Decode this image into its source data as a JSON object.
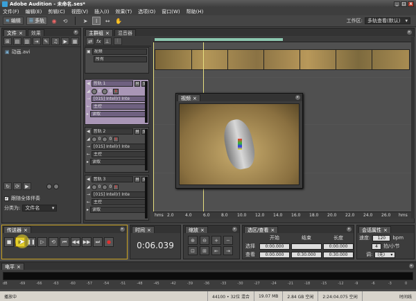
{
  "window": {
    "title": "Adobe Audition - 未命名.ses*",
    "min": "_",
    "max": "□",
    "close": "x"
  },
  "menu": [
    "文件(F)",
    "编辑(E)",
    "剪辑(C)",
    "视图(V)",
    "插入(I)",
    "效果(T)",
    "选项(O)",
    "窗口(W)",
    "帮助(H)"
  ],
  "toolbar": {
    "edit_label": "编辑",
    "multitrack_label": "多轨",
    "workspace_label": "工作区:",
    "workspace_value": "多轨查看(默认)"
  },
  "files_panel": {
    "tab_files": "文件",
    "tab_effects": "效果",
    "item": "动画.avi",
    "checkbox_label": "跟随全体伴奏",
    "sort_label": "分类为:",
    "sort_value": "文件名"
  },
  "main_panel": {
    "tab_main": "主群组",
    "tab_mixer": "混音器"
  },
  "tracks": [
    {
      "name": "视频",
      "field": "所有"
    },
    {
      "name": "音轨 1",
      "vol": "0",
      "pan": "0",
      "input": "[01S] Intel(r) Inte",
      "output": "主控",
      "mode": "读取"
    },
    {
      "name": "音轨 2",
      "vol": "0",
      "pan": "0",
      "input": "[01S] Intel(r) Inte",
      "output": "主控",
      "mode": "读取"
    },
    {
      "name": "音轨 3",
      "vol": "0",
      "pan": "0",
      "input": "[01S] Intel(r) Inte",
      "output": "主控",
      "mode": "读取"
    }
  ],
  "track_buttons": {
    "m": "M",
    "s": "S",
    "r": "R"
  },
  "video_window": {
    "tab": "视频"
  },
  "ruler": {
    "unit": "hms",
    "ticks": [
      "2.0",
      "4.0",
      "6.0",
      "8.0",
      "10.0",
      "12.0",
      "14.0",
      "16.0",
      "18.0",
      "20.0",
      "22.0",
      "24.0",
      "26.0"
    ],
    "end": "hms"
  },
  "transport": {
    "tab": "传送器"
  },
  "time": {
    "tab": "时间",
    "value": "0:06.039"
  },
  "zoom": {
    "tab": "缩放"
  },
  "selection": {
    "tab": "选区/查看",
    "col_start": "开始",
    "col_end": "结束",
    "col_length": "长度",
    "row_sel": "选择",
    "row_view": "查看",
    "sel_start": "0:00.000",
    "sel_end": "",
    "sel_length": "0:00.000",
    "view_start": "0:00.000",
    "view_end": "0:30.000",
    "view_length": "0:30.000"
  },
  "session": {
    "tab": "会话属性",
    "tempo_label": "速度:",
    "tempo_value": "120",
    "tempo_unit": "bpm",
    "beats_value": "4",
    "beats_unit": "拍/小节",
    "key_label": "调:",
    "key_value": "(无)"
  },
  "level": {
    "tab": "电平",
    "scale": [
      "dB",
      "-69",
      "-66",
      "-63",
      "-60",
      "-57",
      "-54",
      "-51",
      "-48",
      "-45",
      "-42",
      "-39",
      "-36",
      "-33",
      "-30",
      "-27",
      "-24",
      "-21",
      "-18",
      "-15",
      "-12",
      "-9",
      "-6",
      "-3",
      "0"
    ]
  },
  "status": {
    "left": "播放中",
    "format": "44100 • 32位 混合",
    "size": "19.07 MB",
    "free1": "2.84 GB 空闲",
    "time": "2:24:04.075 空闲",
    "right": "时间线"
  }
}
